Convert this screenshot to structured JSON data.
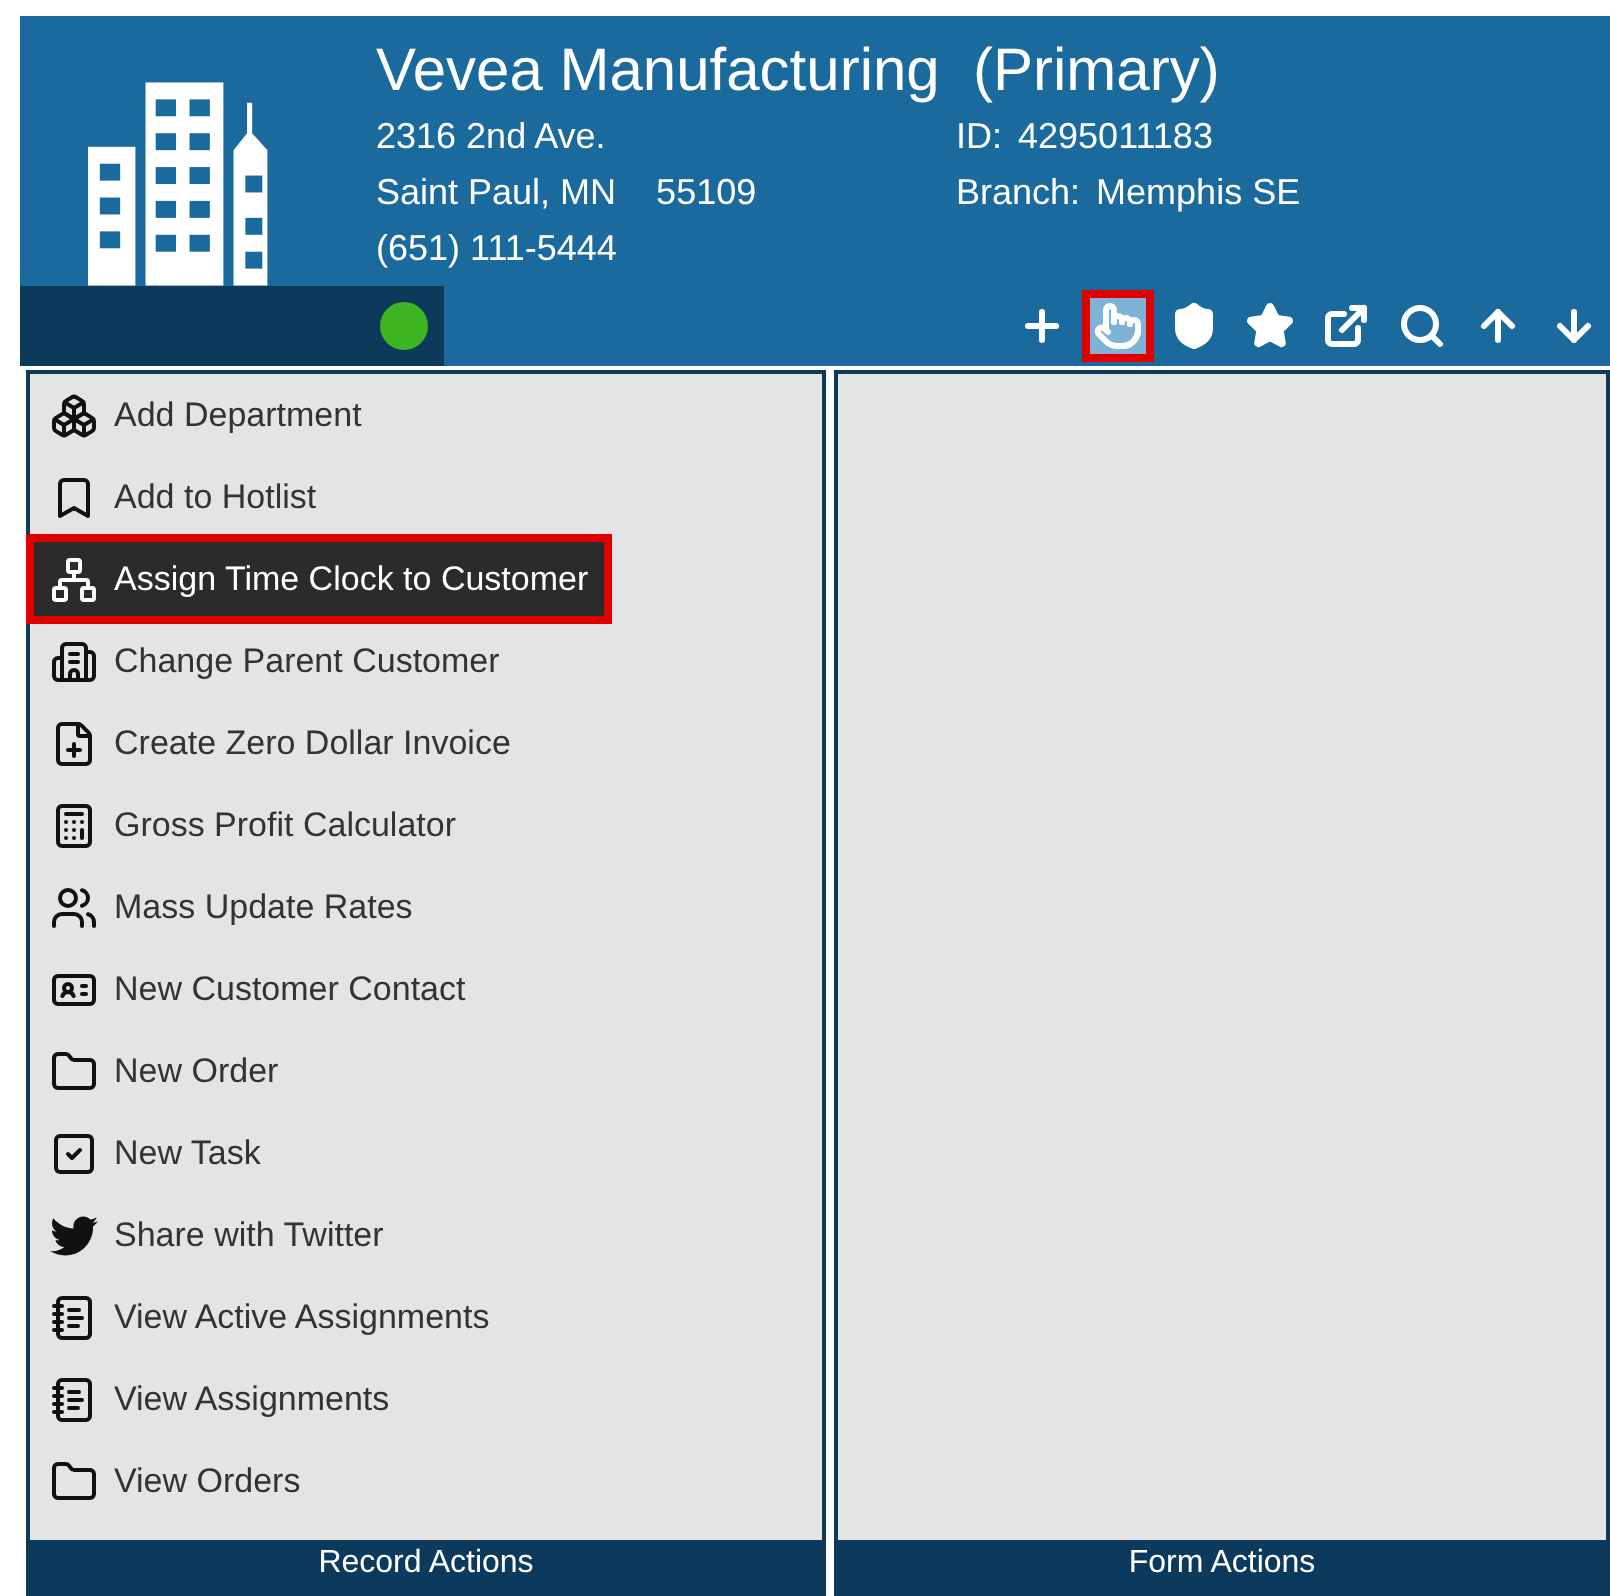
{
  "header": {
    "name": "Vevea Manufacturing  (Primary)",
    "address_line_1": "2316 2nd Ave.",
    "address_line_2": "Saint Paul, MN    55109",
    "phone": "(651) 111-5444",
    "id_label": "ID:",
    "id_value": "4295011183",
    "branch_label": "Branch:",
    "branch_value": "Memphis SE",
    "status": {
      "color": "#3cb521"
    }
  },
  "toolbar": [
    {
      "kind": "add",
      "selected": false,
      "highlighted": false
    },
    {
      "kind": "pointer",
      "selected": true,
      "highlighted": true
    },
    {
      "kind": "badge",
      "selected": false,
      "highlighted": false
    },
    {
      "kind": "star",
      "selected": false,
      "highlighted": false
    },
    {
      "kind": "external",
      "selected": false,
      "highlighted": false
    },
    {
      "kind": "search",
      "selected": false,
      "highlighted": false
    },
    {
      "kind": "up",
      "selected": false,
      "highlighted": false
    },
    {
      "kind": "down",
      "selected": false,
      "highlighted": false
    }
  ],
  "record_actions": {
    "title": "Record Actions",
    "items": [
      {
        "label": "Add Department",
        "kind": "department",
        "selected": false,
        "highlighted": false
      },
      {
        "label": "Add to Hotlist",
        "kind": "bookmark",
        "selected": false,
        "highlighted": false
      },
      {
        "label": "Assign Time Clock to Customer",
        "kind": "nodes",
        "selected": true,
        "highlighted": true
      },
      {
        "label": "Change Parent Customer",
        "kind": "buildings",
        "selected": false,
        "highlighted": false
      },
      {
        "label": "Create Zero Dollar Invoice",
        "kind": "invoice",
        "selected": false,
        "highlighted": false
      },
      {
        "label": "Gross Profit Calculator",
        "kind": "calculator",
        "selected": false,
        "highlighted": false
      },
      {
        "label": "Mass Update Rates",
        "kind": "people",
        "selected": false,
        "highlighted": false
      },
      {
        "label": "New Customer Contact",
        "kind": "card",
        "selected": false,
        "highlighted": false
      },
      {
        "label": "New Order",
        "kind": "folder",
        "selected": false,
        "highlighted": false
      },
      {
        "label": "New Task",
        "kind": "task",
        "selected": false,
        "highlighted": false
      },
      {
        "label": "Share with Twitter",
        "kind": "twitter",
        "selected": false,
        "highlighted": false
      },
      {
        "label": "View Active Assignments",
        "kind": "notepad",
        "selected": false,
        "highlighted": false
      },
      {
        "label": "View Assignments",
        "kind": "notepad",
        "selected": false,
        "highlighted": false
      },
      {
        "label": "View Orders",
        "kind": "folder",
        "selected": false,
        "highlighted": false
      }
    ]
  },
  "form_actions": {
    "title": "Form Actions"
  }
}
